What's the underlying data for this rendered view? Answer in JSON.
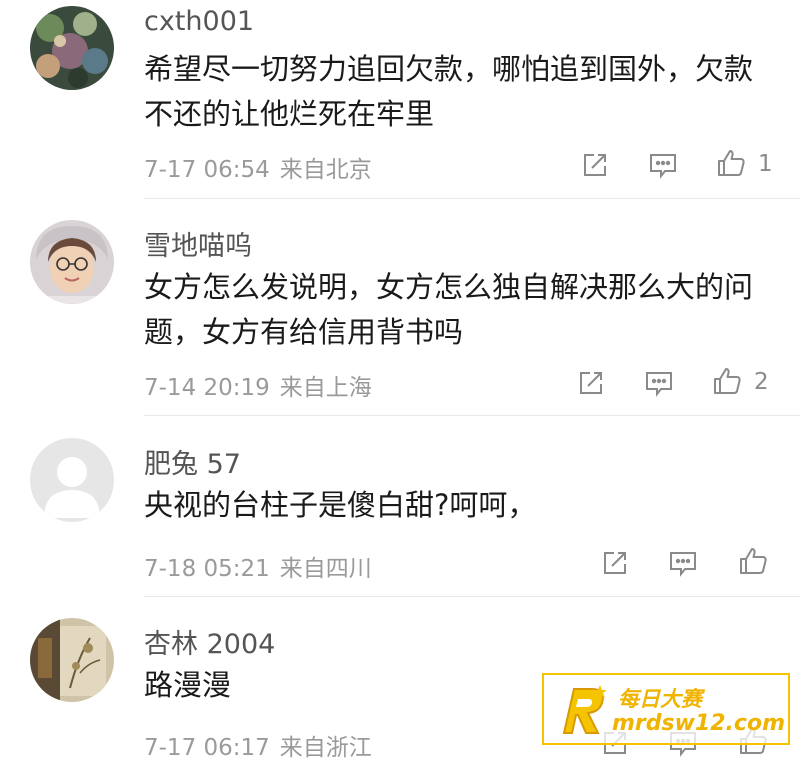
{
  "comments": [
    {
      "username": "cxth001",
      "text": "希望尽一切努力追回欠款，哪怕追到国外，欠款不还的让他烂死在牢里",
      "date": "7-17 06:54",
      "location": "来自北京",
      "likes": "1"
    },
    {
      "username": "雪地喵呜",
      "text": "女方怎么发说明，女方怎么独自解决那么大的问题，女方有给信用背书吗",
      "date": "7-14 20:19",
      "location": "来自上海",
      "likes": "2"
    },
    {
      "username": "肥兔 57",
      "text": "央视的台柱子是傻白甜?呵呵，",
      "date": "7-18 05:21",
      "location": "来自四川",
      "likes": ""
    },
    {
      "username": "杏林 2004",
      "text": "路漫漫",
      "date": "7-17 06:17",
      "location": "来自浙江",
      "likes": ""
    }
  ],
  "icons": {
    "share": "share-icon",
    "reply": "comment-icon",
    "like": "thumbs-up-icon"
  },
  "watermark": {
    "line1": "每日大赛",
    "line2": "mrdsw12.com"
  }
}
